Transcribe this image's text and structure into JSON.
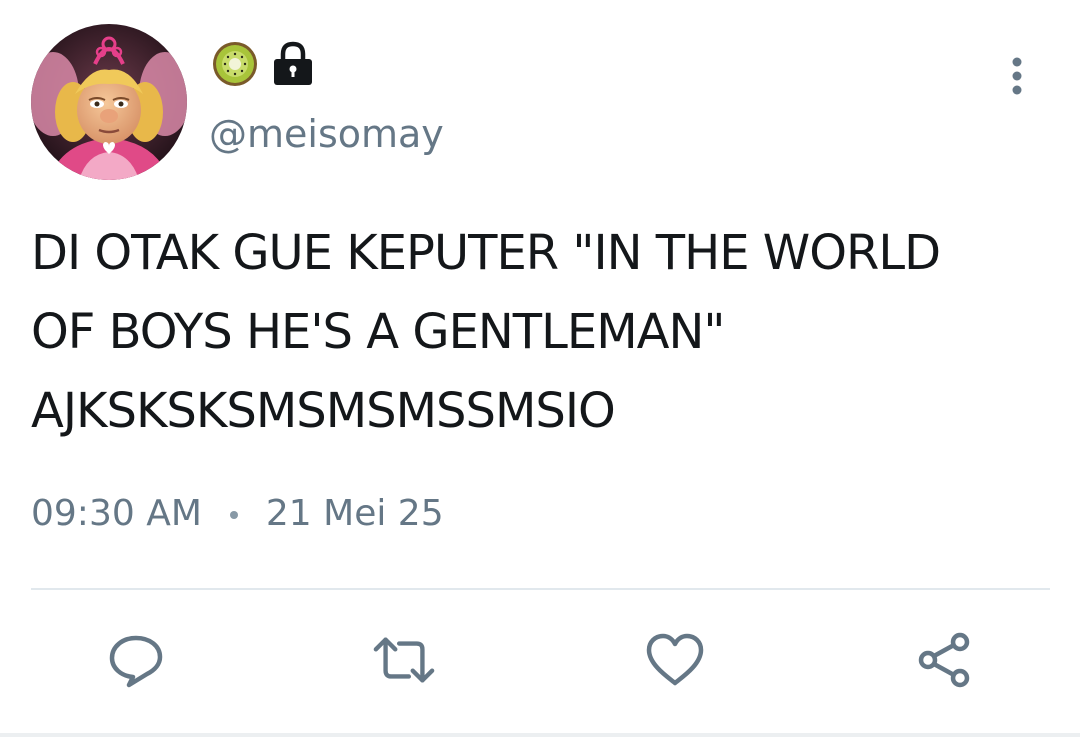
{
  "user": {
    "name_emoji": "kiwi-icon",
    "protected_icon": "lock-icon",
    "handle": "@meisomay"
  },
  "tweet": {
    "text": "DI OTAK GUE KEPUTER \"IN THE WORLD\nOF BOYS HE'S A GENTLEMAN\"\nAJKSKSKSMSMSMSSMSIO",
    "time": "09:30 AM",
    "date": "21 Mei 25"
  },
  "actions": [
    {
      "name": "reply",
      "icon": "reply-icon"
    },
    {
      "name": "retweet",
      "icon": "retweet-icon"
    },
    {
      "name": "like",
      "icon": "heart-icon"
    },
    {
      "name": "share",
      "icon": "share-icon"
    }
  ],
  "colors": {
    "text": "#14171a",
    "secondary": "#657786",
    "divider": "#e1e8ed"
  }
}
